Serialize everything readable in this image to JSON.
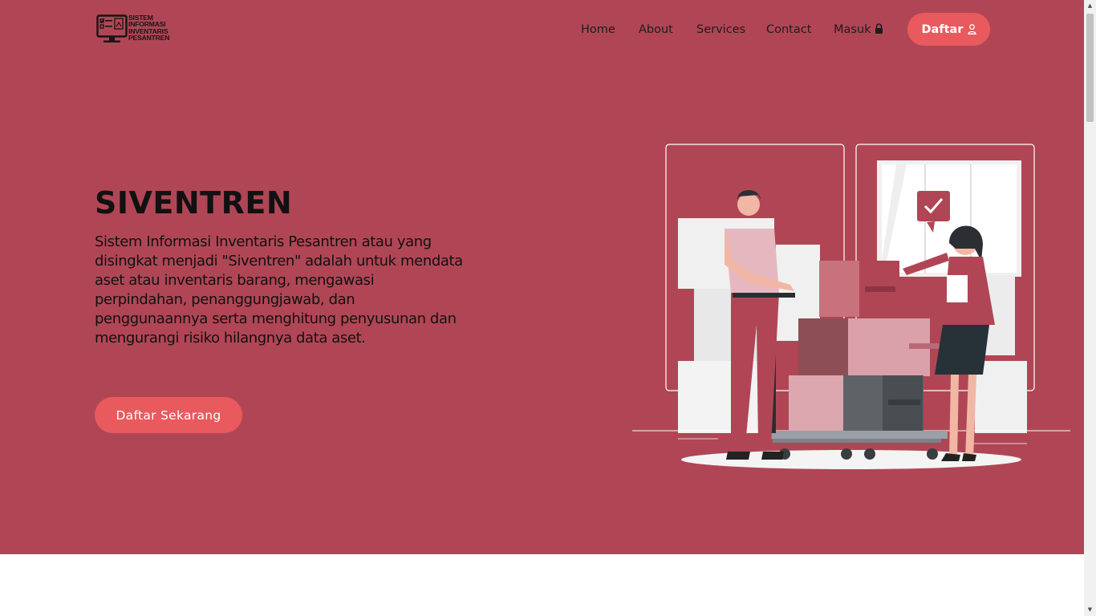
{
  "header": {
    "logo": {
      "lines": [
        "SISTEM",
        "INFORMASI",
        "INVENTARIS",
        "PESANTREN"
      ]
    },
    "nav": [
      {
        "label": "Home"
      },
      {
        "label": "About"
      },
      {
        "label": "Services"
      },
      {
        "label": "Contact"
      },
      {
        "label": "Masuk",
        "icon": "lock-icon"
      }
    ],
    "register_button": {
      "label": "Daftar",
      "icon": "user-icon"
    }
  },
  "hero": {
    "title": "SIVENTREN",
    "description": "Sistem Informasi Inventaris Pesantren atau yang disingkat menjadi \"Siventren\" adalah untuk mendata aset atau inventaris barang, mengawasi perpindahan, penanggungjawab, dan penggunaannya serta menghitung penyusunan dan mengurangi risiko hilangnya data aset.",
    "cta_label": "Daftar Sekarang",
    "illustration": "inventory-illustration"
  },
  "colors": {
    "hero_background": "#b04655",
    "button": "#e85a5d",
    "text": "#111111",
    "button_text": "#ffffff"
  }
}
